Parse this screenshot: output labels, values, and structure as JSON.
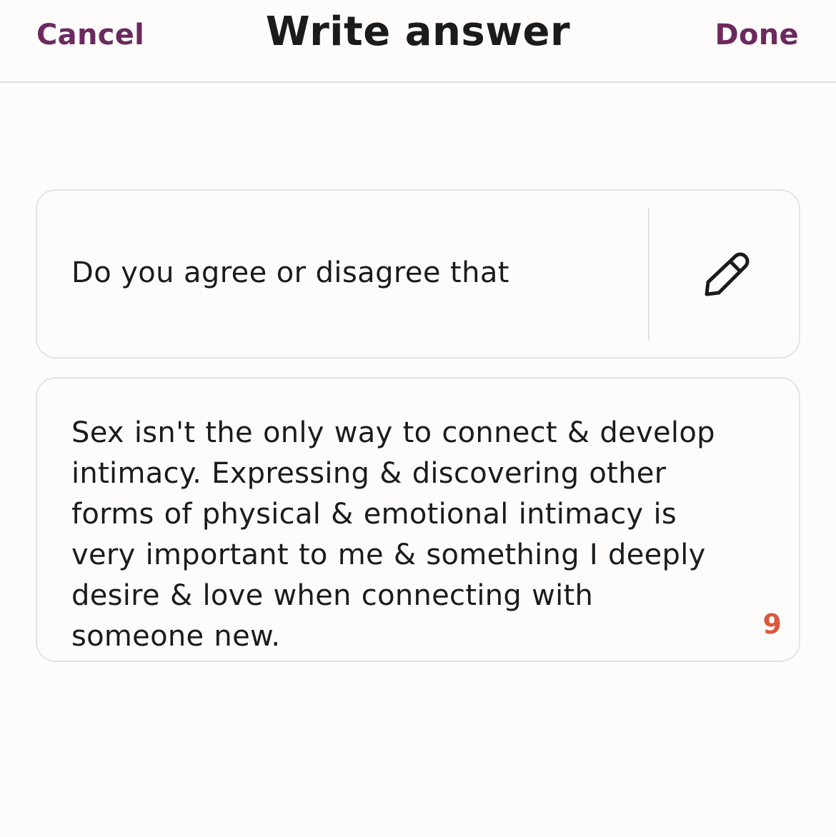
{
  "header": {
    "cancel_label": "Cancel",
    "title": "Write answer",
    "done_label": "Done"
  },
  "prompt": {
    "text": "Do you agree or disagree that",
    "edit_icon": "pencil-icon"
  },
  "answer": {
    "lines": [
      "Sex isn't the only way to connect & develop",
      "intimacy. Expressing & discovering other",
      "forms of physical & emotional intimacy is",
      "very important to me & something I deeply",
      "desire & love when connecting with",
      "someone new."
    ],
    "remaining_characters": "9"
  },
  "colors": {
    "accent": "#6b2a5f",
    "counter_warning": "#d9583e",
    "background": "#fdfcfb",
    "border": "#e6e4e1",
    "text": "#1b1b1b"
  }
}
